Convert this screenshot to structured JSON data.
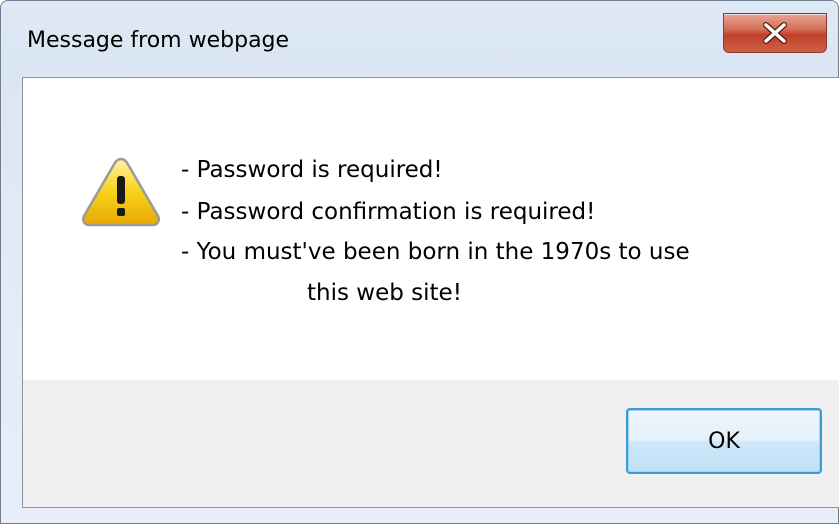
{
  "window": {
    "title": "Message from webpage"
  },
  "icons": {
    "close": "close-icon",
    "warning": "warning-icon"
  },
  "message": {
    "lines": [
      "- Password is required!",
      "- Password confirmation is required!",
      "- You must've been born in the 1970s to use",
      "this web site!"
    ]
  },
  "buttons": {
    "ok_label": "OK"
  },
  "colors": {
    "close_button": "#c7462f",
    "ok_border": "#3c9ad6",
    "button_area": "#f0f0f0",
    "warning_yellow": "#f5c400"
  }
}
